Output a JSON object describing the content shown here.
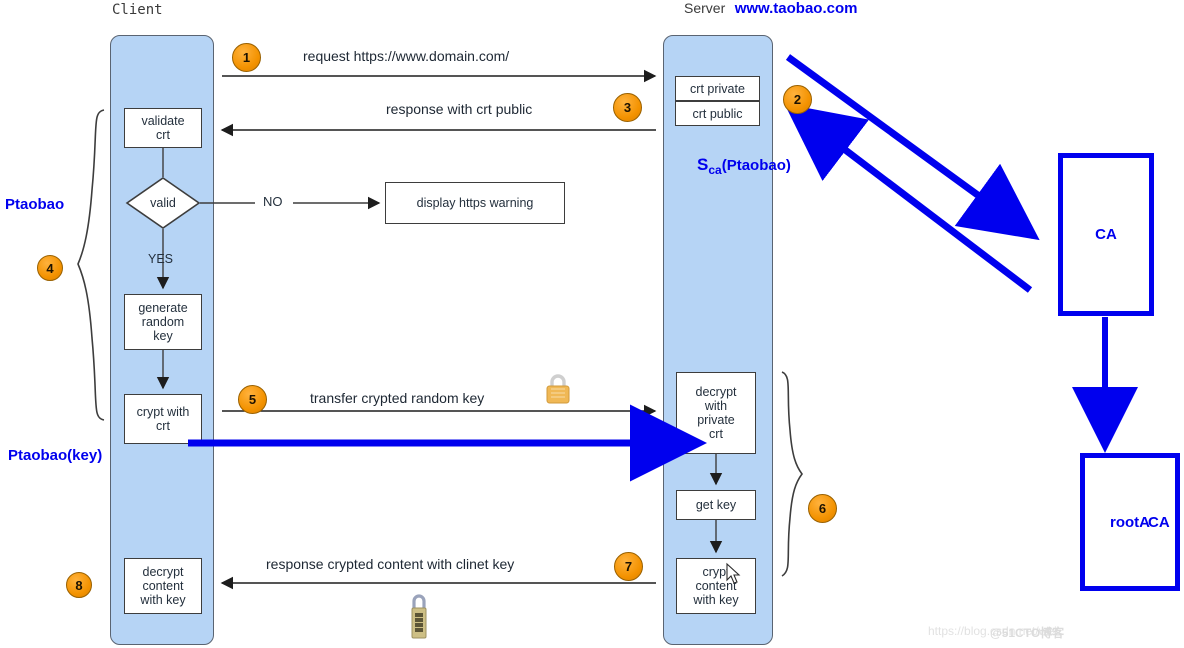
{
  "headers": {
    "client": "Client",
    "server_prefix": "Server",
    "server_domain": "www.taobao.com"
  },
  "server": {
    "crt_private": "crt private",
    "crt_public": "crt public",
    "signature_s": "S",
    "signature_sub": "ca",
    "signature_rest": "(Ptaobao)"
  },
  "client_flow": {
    "validate_crt": "validate\ncrt",
    "valid_decision": "valid",
    "no_label": "NO",
    "yes_label": "YES",
    "https_warning": "display https warning",
    "generate_random_key": "generate\nrandom\nkey",
    "crypt_with_crt": "crypt with\ncrt",
    "decrypt_content_with_key": "decrypt\ncontent\nwith key"
  },
  "server_flow": {
    "decrypt_with_private_crt": "decrypt\nwith\nprivate\ncrt",
    "get_key": "get key",
    "crypt_content_with_key": "crypt\ncontent\nwith key"
  },
  "messages": {
    "step1": "request https://www.domain.com/",
    "step3": "response with crt public",
    "step5": "transfer crypted random key",
    "step7": "response crypted content with clinet key"
  },
  "badges": {
    "b1": "1",
    "b2": "2",
    "b3": "3",
    "b4": "4",
    "b5": "5",
    "b6": "6",
    "b7": "7",
    "b8": "8"
  },
  "annotations": {
    "ptaobao": "Ptaobao",
    "ptaobao_key": "Ptaobao(key)"
  },
  "ca": {
    "ca_label": "CA",
    "root_ca_base": "rootA",
    "root_ca_over": "CA"
  },
  "watermark": {
    "url": "https://blog.csdn.net/wei",
    "site": "@51CTO博客"
  },
  "colors": {
    "lane_fill": "#b6d4f5",
    "badge_orange": "#f39200",
    "accent_blue": "#0000ee",
    "box_stroke": "#3d3d3d"
  },
  "icons": {
    "padlock_closed": "padlock-icon",
    "padlock_combination": "combination-padlock-icon",
    "cursor": "mouse-cursor-icon"
  }
}
